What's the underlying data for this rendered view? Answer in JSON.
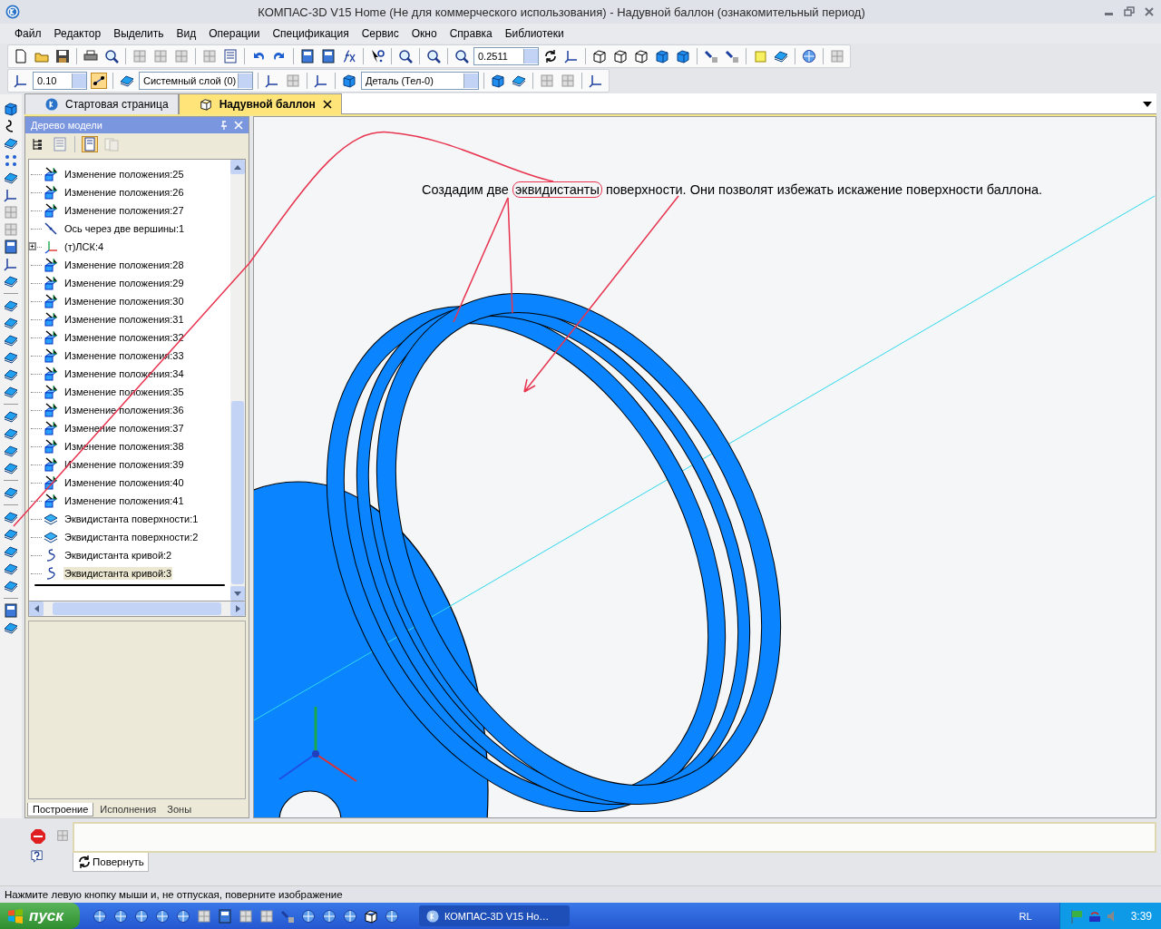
{
  "window": {
    "title": "КОМПАС-3D V15 Home (Не для коммерческого использования) - Надувной баллон (ознакомительный период)"
  },
  "menu": [
    "Файл",
    "Редактор",
    "Выделить",
    "Вид",
    "Операции",
    "Спецификация",
    "Сервис",
    "Окно",
    "Справка",
    "Библиотеки"
  ],
  "toolbar": {
    "scale": "0.2511",
    "step": "0.10",
    "layer": "Системный слой (0)",
    "state": "Деталь (Тел-0)"
  },
  "document_tabs": [
    {
      "label": "Стартовая страница",
      "selected": false
    },
    {
      "label": "Надувной баллон",
      "selected": true
    }
  ],
  "model_tree": {
    "title": "Дерево модели",
    "items": [
      {
        "kind": "move",
        "label": "Изменение положения:25",
        "selected": false
      },
      {
        "kind": "move",
        "label": "Изменение положения:26",
        "selected": false
      },
      {
        "kind": "move",
        "label": "Изменение положения:27",
        "selected": false
      },
      {
        "kind": "axis",
        "label": "Ось через две вершины:1",
        "selected": false
      },
      {
        "kind": "lcs",
        "label": "(т)ЛСК:4",
        "selected": false,
        "expanded": false
      },
      {
        "kind": "move",
        "label": "Изменение положения:28",
        "selected": false
      },
      {
        "kind": "move",
        "label": "Изменение положения:29",
        "selected": false
      },
      {
        "kind": "move",
        "label": "Изменение положения:30",
        "selected": false
      },
      {
        "kind": "move",
        "label": "Изменение положения:31",
        "selected": false
      },
      {
        "kind": "move",
        "label": "Изменение положения:32",
        "selected": false
      },
      {
        "kind": "move",
        "label": "Изменение положения:33",
        "selected": false
      },
      {
        "kind": "move",
        "label": "Изменение положения:34",
        "selected": false
      },
      {
        "kind": "move",
        "label": "Изменение положения:35",
        "selected": false
      },
      {
        "kind": "move",
        "label": "Изменение положения:36",
        "selected": false
      },
      {
        "kind": "move",
        "label": "Изменение положения:37",
        "selected": false
      },
      {
        "kind": "move",
        "label": "Изменение положения:38",
        "selected": false
      },
      {
        "kind": "move",
        "label": "Изменение положения:39",
        "selected": false
      },
      {
        "kind": "move",
        "label": "Изменение положения:40",
        "selected": false
      },
      {
        "kind": "move",
        "label": "Изменение положения:41",
        "selected": false
      },
      {
        "kind": "surface",
        "label": "Эквидистанта поверхности:1",
        "selected": false
      },
      {
        "kind": "surface",
        "label": "Эквидистанта поверхности:2",
        "selected": false
      },
      {
        "kind": "curve",
        "label": "Эквидистанта кривой:2",
        "selected": false
      },
      {
        "kind": "curve",
        "label": "Эквидистанта кривой:3",
        "selected": true
      }
    ],
    "tabs": [
      {
        "label": "Построение",
        "selected": true
      },
      {
        "label": "Исполнения",
        "selected": false
      },
      {
        "label": "Зоны",
        "selected": false
      }
    ]
  },
  "viewport": {
    "annotation": {
      "before": "Создадим две ",
      "highlight": "эквидистанты",
      "after": " поверхности. Они позволят избежать искажение поверхности баллона."
    }
  },
  "command_panel": {
    "tab": "Повернуть"
  },
  "status_bar": "Нажмите левую кнопку мыши и, не отпуская, поверните изображение",
  "taskbar": {
    "start": "пуск",
    "task": "КОМПАС-3D V15 Ho…",
    "language": "RL",
    "clock": "3:39"
  }
}
